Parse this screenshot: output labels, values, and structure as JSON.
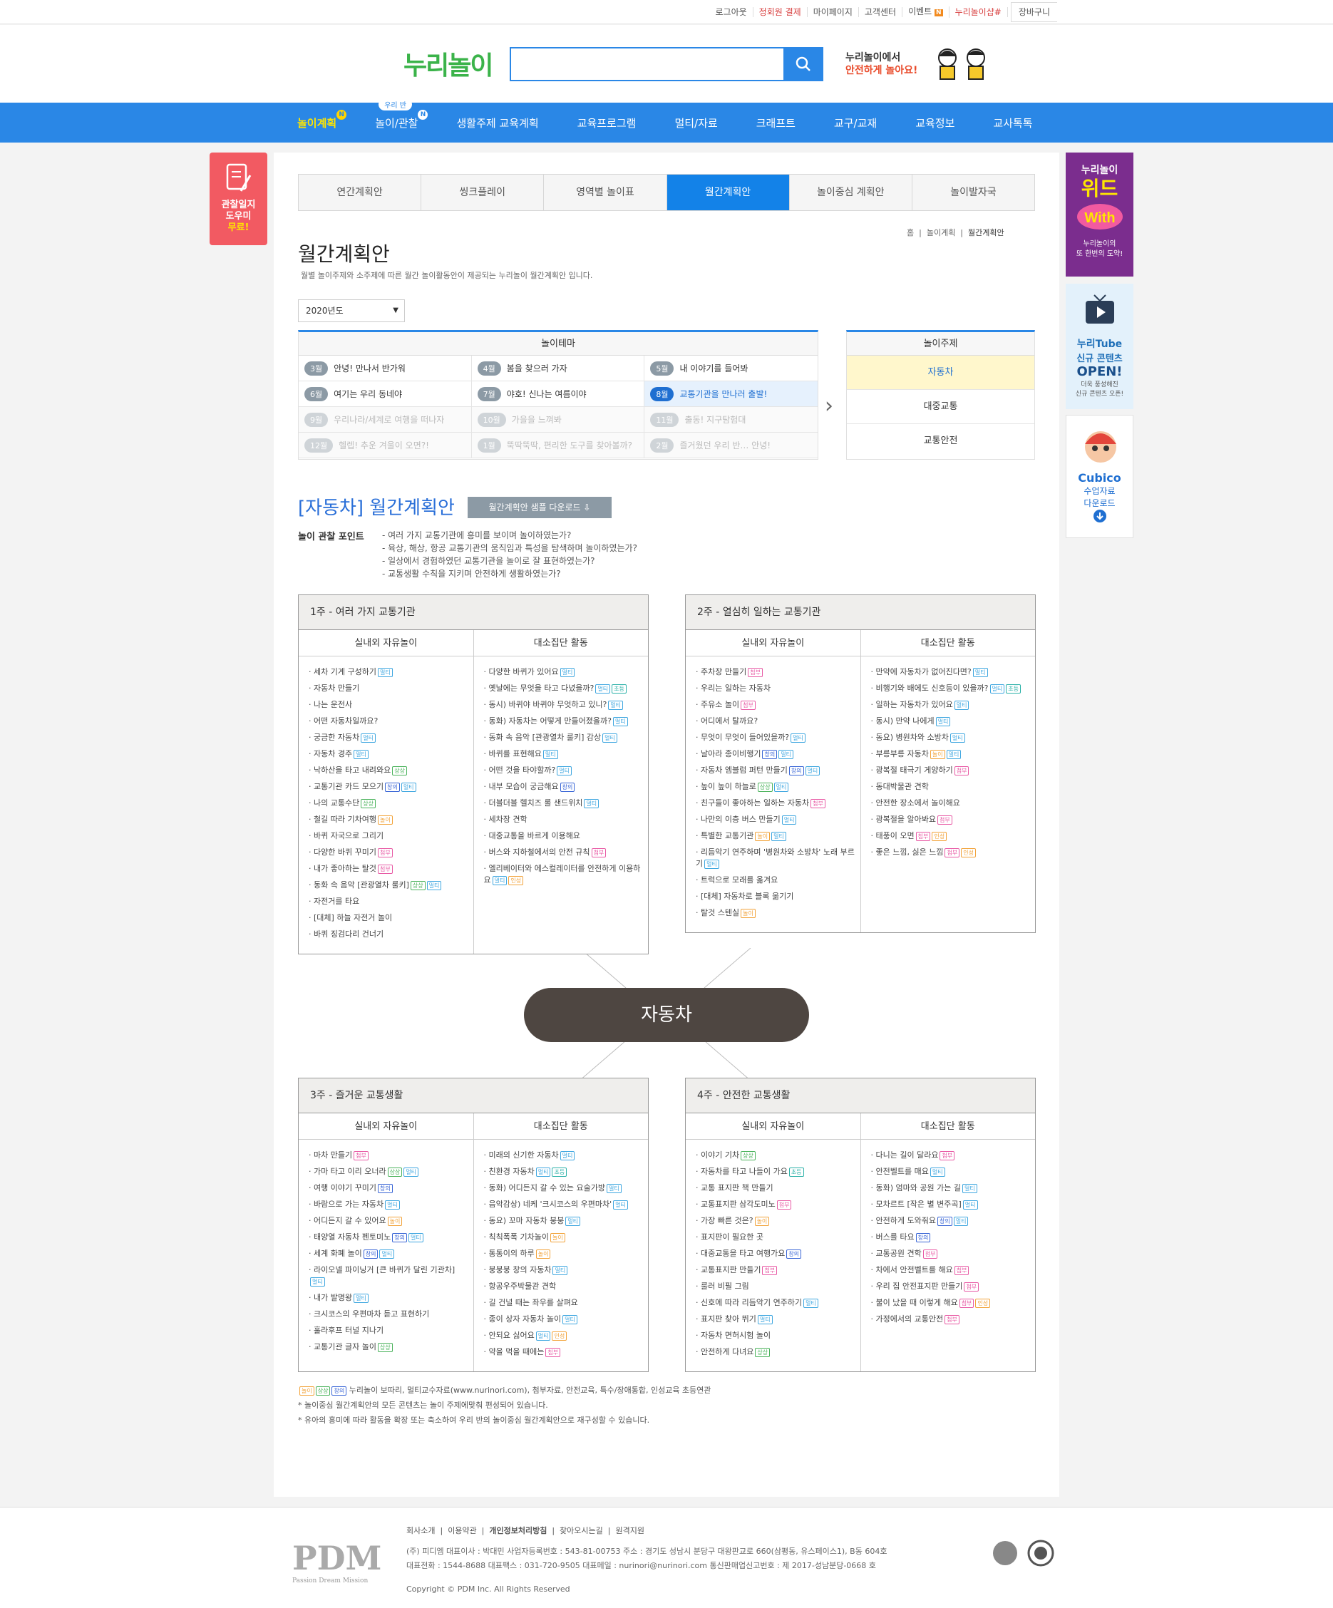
{
  "top_links": [
    "로그아웃",
    "정회원 결제",
    "마이페이지",
    "고객센터",
    "이벤트",
    "누리놀이샵#",
    "장바구니"
  ],
  "header": {
    "logo": "누리놀이",
    "slogan1": "누리놀이에서",
    "slogan2": "안전하게 놀아요!"
  },
  "nav": {
    "items": [
      "놀이계획",
      "놀이/관찰",
      "생활주제 교육계획",
      "교육프로그램",
      "멀티/자료",
      "크래프트",
      "교구/교재",
      "교육정보",
      "교사톡톡"
    ],
    "badge": "N",
    "sub_badge": "우리 반"
  },
  "left_banner": {
    "line1": "관찰일지",
    "line2": "도우미",
    "line3": "무료!"
  },
  "right_banners": {
    "b1": [
      "누리놀이",
      "위드",
      "누리놀이의",
      "또 한번의 도약!"
    ],
    "b2": [
      "누리Tube",
      "신규 콘텐츠",
      "OPEN!",
      "더욱 풍성해진",
      "신규 콘텐츠 오픈!"
    ],
    "b3": [
      "Cubico",
      "수업자료",
      "다운로드"
    ]
  },
  "tabs": [
    "연간계획안",
    "씽크플레이",
    "영역별 놀이표",
    "월간계획안",
    "놀이중심 계획안",
    "놀이발자국"
  ],
  "breadcrumb": [
    "홈",
    "놀이계획",
    "월간계획안"
  ],
  "page": {
    "title": "월간계획안",
    "desc": "월별 놀이주제와 소주제에 따른 월간 놀이활동안이 제공되는 누리놀이 월간계획안 입니다.",
    "year": "2020년도"
  },
  "theme": {
    "header": "놀이테마",
    "rows": [
      [
        {
          "m": "3월",
          "t": "안녕! 만나서 반가워"
        },
        {
          "m": "4월",
          "t": "봄을 찾으러 가자"
        },
        {
          "m": "5월",
          "t": "내 이야기를 들어봐"
        }
      ],
      [
        {
          "m": "6월",
          "t": "여기는 우리 동네야"
        },
        {
          "m": "7월",
          "t": "야호! 신나는 여름이야"
        },
        {
          "m": "8월",
          "t": "교통기관을 만나러 출발!"
        }
      ],
      [
        {
          "m": "9월",
          "t": "우리나라/세계로 여행을 떠나자"
        },
        {
          "m": "10월",
          "t": "가을을 느껴봐"
        },
        {
          "m": "11월",
          "t": "출동! 지구탐험대"
        }
      ],
      [
        {
          "m": "12월",
          "t": "헬렙! 추운 겨울이 오면?!"
        },
        {
          "m": "1월",
          "t": "뚝딱뚝딱, 편리한 도구를 찾아볼까?"
        },
        {
          "m": "2월",
          "t": "즐거웠던 우리 반… 안녕!"
        }
      ]
    ]
  },
  "subject": {
    "header": "놀이주제",
    "items": [
      "자동차",
      "대중교통",
      "교통안전"
    ]
  },
  "section": {
    "title": "[자동차] 월간계획안",
    "download": "월간계획안 샘플 다운로드",
    "points_label": "놀이 관찰 포인트",
    "points": [
      "- 여러 가지 교통기관에 흥미를 보이며 놀이하였는가?",
      "- 육상, 해상, 항공 교통기관의 움직임과 특성을 탐색하며 놀이하였는가?",
      "- 일상에서 경험하였던 교통기관을 놀이로 잘 표현하였는가?",
      "- 교통생활 수칙을 지키며 안전하게 생활하였는가?"
    ]
  },
  "col_headers": [
    "실내외 자유놀이",
    "대소집단 활동"
  ],
  "center": "자동차",
  "weeks": [
    {
      "title": "1주 - 여러 가지 교통기관",
      "free": [
        [
          "세차 기계 구성하기",
          [
            "멀티"
          ]
        ],
        [
          "자동차 만들기",
          []
        ],
        [
          "나는 운전사",
          []
        ],
        [
          "어떤 자동차일까요?",
          []
        ],
        [
          "궁금한 자동차",
          [
            "멀티"
          ]
        ],
        [
          "자동차 경주",
          [
            "멀티"
          ]
        ],
        [
          "낙하산을 타고 내려와요",
          [
            "상상"
          ]
        ],
        [
          "교통기관 카드 모으기",
          [
            "창의",
            "멀티"
          ]
        ],
        [
          "나의 교통수단",
          [
            "상상"
          ]
        ],
        [
          "철길 따라 기차여행",
          [
            "놀이"
          ]
        ],
        [
          "바퀴 자국으로 그리기",
          []
        ],
        [
          "다양한 바퀴 꾸미기",
          [
            "첨부"
          ]
        ],
        [
          "내가 좋아하는 탈것",
          [
            "첨부"
          ]
        ],
        [
          "동화 속 음악 [관광열차 룰키]",
          [
            "상상",
            "멀티"
          ]
        ],
        [
          "자전거를 타요",
          []
        ],
        [
          "[대체] 하늘 자전거 놀이",
          []
        ],
        [
          "바퀴 징검다리 건너기",
          []
        ]
      ],
      "group": [
        [
          "다양한 바퀴가 있어요",
          [
            "멀티"
          ]
        ],
        [
          "옛날에는 무엇을 타고 다녔을까?",
          [
            "멀티",
            "초등"
          ]
        ],
        [
          "동시) 바퀴야 바퀴야 무엇하고 있니?",
          [
            "멀티"
          ]
        ],
        [
          "동화) 자동차는 어떻게 만들어졌을까?",
          [
            "멀티"
          ]
        ],
        [
          "동화 속 음악 [관광열차 룰키] 감상",
          [
            "멀티"
          ]
        ],
        [
          "바퀴를 표현해요",
          [
            "멀티"
          ]
        ],
        [
          "어떤 것을 타야할까?",
          [
            "멀티"
          ]
        ],
        [
          "내부 모습이 궁금해요",
          [
            "창의"
          ]
        ],
        [
          "더블더블 헬치즈 롤 샌드위치",
          [
            "멀티"
          ]
        ],
        [
          "세차장 견학",
          []
        ],
        [
          "대중교통을 바르게 이용해요",
          []
        ],
        [
          "버스와 지하철에서의 안전 규칙",
          [
            "첨부"
          ]
        ],
        [
          "엘리베이터와 에스컬레이터를 안전하게 이용하요",
          [
            "멀티",
            "인성"
          ]
        ]
      ]
    },
    {
      "title": "2주 - 열심히 일하는 교통기관",
      "free": [
        [
          "주차장 만들기",
          [
            "첨부"
          ]
        ],
        [
          "우리는 일하는 자동차",
          []
        ],
        [
          "주유소 놀이",
          [
            "첨부"
          ]
        ],
        [
          "어디에서 탈까요?",
          []
        ],
        [
          "무엇이 무엇이 들어있을까?",
          [
            "멀티"
          ]
        ],
        [
          "날아라 종이비행기",
          [
            "창의",
            "멀티"
          ]
        ],
        [
          "자동차 엠블럼 퍼턴 만들기",
          [
            "창의",
            "멀티"
          ]
        ],
        [
          "높이 높이 하늘로",
          [
            "상상",
            "멀티"
          ]
        ],
        [
          "친구들이 좋아하는 일하는 자동차",
          [
            "첨부"
          ]
        ],
        [
          "나만의 이층 버스 만들기",
          [
            "멀티"
          ]
        ],
        [
          "특별한 교통기관",
          [
            "놀이",
            "멀티"
          ]
        ],
        [
          "리듬악기 연주하며 '병원차와 소방차' 노래 부르기",
          [
            "멀티"
          ]
        ],
        [
          "트럭으로 모래를 옮겨요",
          []
        ],
        [
          "[대체] 자동차로 블록 옮기기",
          []
        ],
        [
          "탈것 스텐실",
          [
            "놀이"
          ]
        ]
      ],
      "group": [
        [
          "만약에 자동차가 없어진다면?",
          [
            "멀티"
          ]
        ],
        [
          "비행기와 배에도 신호등이 있을까?",
          [
            "멀티",
            "초등"
          ]
        ],
        [
          "일하는 자동차가 있어요",
          [
            "멀티"
          ]
        ],
        [
          "동시) 만약 나에게",
          [
            "멀티"
          ]
        ],
        [
          "동요) 병원차와 소방차",
          [
            "멀티"
          ]
        ],
        [
          "부릉부릉 자동차",
          [
            "놀이",
            "멀티"
          ]
        ],
        [
          "광복절 태극기 게양하기",
          [
            "첨부"
          ]
        ],
        [
          "동대박물관 견학",
          []
        ],
        [
          "안전한 장소에서 놀이해요",
          []
        ],
        [
          "광복절을 알아봐요",
          [
            "첨부"
          ]
        ],
        [
          "태풍이 오면",
          [
            "첨부",
            "인성"
          ]
        ],
        [
          "좋은 느낌, 싫은 느낌",
          [
            "첨부",
            "인성"
          ]
        ]
      ]
    },
    {
      "title": "3주 - 즐거운 교통생활",
      "free": [
        [
          "마차 만들기",
          [
            "첨부"
          ]
        ],
        [
          "가마 타고 이리 오너라",
          [
            "상상",
            "멀티"
          ]
        ],
        [
          "여행 이야기 꾸미기",
          [
            "창의"
          ]
        ],
        [
          "바람으로 가는 자동차",
          [
            "멀티"
          ]
        ],
        [
          "어디든지 갈 수 있어요",
          [
            "놀이"
          ]
        ],
        [
          "태양열 자동차 펜토미노",
          [
            "창의",
            "멀티"
          ]
        ],
        [
          "세계 화폐 놀이",
          [
            "창의",
            "멀티"
          ]
        ],
        [
          "라이오넬 파이닝거 [큰 바퀴가 달린 기관차]",
          [
            "멀티"
          ]
        ],
        [
          "내가 발명왕",
          [
            "멀티"
          ]
        ],
        [
          "크시코스의 우편마차 듣고 표현하기",
          []
        ],
        [
          "훌라후프 터널 지나기",
          []
        ],
        [
          "교통기관 글자 놀이",
          [
            "상상"
          ]
        ]
      ],
      "group": [
        [
          "미래의 신기한 자동차",
          [
            "멀티"
          ]
        ],
        [
          "친환경 자동차",
          [
            "멀티",
            "초등"
          ]
        ],
        [
          "동화) 어디든지 갈 수 있는 요술가방",
          [
            "멀티"
          ]
        ],
        [
          "음악감상) 네케 '크시코스의 우편마차'",
          [
            "멀티"
          ]
        ],
        [
          "동요) 꼬마 자동차 붕붕",
          [
            "멀티"
          ]
        ],
        [
          "칙칙폭폭 기차놀이",
          [
            "놀이"
          ]
        ],
        [
          "통통이의 하루",
          [
            "놀이"
          ]
        ],
        [
          "붕붕붕 창의 자동차",
          [
            "멀티"
          ]
        ],
        [
          "항공우주박물관 견학",
          []
        ],
        [
          "길 건널 때는 좌우를 살펴요",
          []
        ],
        [
          "종이 상자 자동차 놀이",
          [
            "멀티"
          ]
        ],
        [
          "안되요 싫어요",
          [
            "멀티",
            "인성"
          ]
        ],
        [
          "약을 먹을 때에는",
          [
            "첨부"
          ]
        ]
      ]
    },
    {
      "title": "4주 - 안전한 교통생활",
      "free": [
        [
          "이야기 기차",
          [
            "상상"
          ]
        ],
        [
          "자동차를 타고 나들이 가요",
          [
            "초등"
          ]
        ],
        [
          "교통 표지판 책 만들기",
          []
        ],
        [
          "교통표지판 삼각도미노",
          [
            "첨부"
          ]
        ],
        [
          "가장 빠른 것은?",
          [
            "놀이"
          ]
        ],
        [
          "표지판이 필요한 곳",
          []
        ],
        [
          "대중교통을 타고 여행가요",
          [
            "창의"
          ]
        ],
        [
          "교통표지판 만들기",
          [
            "첨부"
          ]
        ],
        [
          "룰러 비필 그림",
          []
        ],
        [
          "신호에 따라 리듬악기 연주하기",
          [
            "멀티"
          ]
        ],
        [
          "표지판 찾아 뛰기",
          [
            "멀티"
          ]
        ],
        [
          "자동차 면허시험 놀이",
          []
        ],
        [
          "안전하게 다녀요",
          [
            "상상"
          ]
        ]
      ],
      "group": [
        [
          "다니는 길이 달라요",
          [
            "첨부"
          ]
        ],
        [
          "안전벨트를 매요",
          [
            "멀티"
          ]
        ],
        [
          "동화) 엄마와 공원 가는 길",
          [
            "멀티"
          ]
        ],
        [
          "모차르트 [작은 별 변주곡]",
          [
            "멀티"
          ]
        ],
        [
          "안전하게 도와줘요",
          [
            "창의",
            "멀티"
          ]
        ],
        [
          "버스를 타요",
          [
            "창의"
          ]
        ],
        [
          "교통공원 견학",
          [
            "첨부"
          ]
        ],
        [
          "차에서 안전벨트를 해요",
          [
            "첨부"
          ]
        ],
        [
          "우리 집 안전표지판 만들기",
          [
            "첨부"
          ]
        ],
        [
          "불이 났을 때 이렇게 해요",
          [
            "첨부",
            "인성"
          ]
        ],
        [
          "가정에서의 교통안전",
          [
            "첨부"
          ]
        ]
      ]
    }
  ],
  "tag_colors": {
    "멀티": "b",
    "첨부": "p",
    "상상": "g",
    "놀이": "o",
    "창의": "n",
    "초등": "c",
    "인성": "o"
  },
  "legend": {
    "line1": "누리놀이 보따리,  멀티교수자료(www.nurinori.com),  첨부자료,  안전교육,  특수/장애통합,  인성교육  초등연관",
    "line2": "* 놀이중심 월간계획안의 모든 콘텐츠는 놀이 주제에맞춰 편성되어 있습니다.",
    "line3": "* 유아의 흥미에 따라 활동을 확장 또는 축소하여 우리 반의 놀이중심 월간계획안으로 재구성할 수 있습니다."
  },
  "footer": {
    "links": [
      "회사소개",
      "이용약관",
      "개인정보처리방침",
      "찾아오시는길",
      "원격지원"
    ],
    "addr1": "(주) 피디엠 대표이사 : 박대민 사업자등록번호 : 543-81-00753 주소 : 경기도 성남시 분당구 대왕판교로 660(삼평동, 유스페이스1), B동 604호",
    "addr2": "대표전화 : 1544-8688 대표팩스 : 031-720-9505 대표메일 : nurinori@nurinori.com 통신판매업신고번호 : 제 2017-성남분당-0668 호",
    "copy": "Copyright © PDM Inc. All Rights Reserved",
    "logo": "PDM",
    "logo_sub": "Passion Dream Mission"
  }
}
